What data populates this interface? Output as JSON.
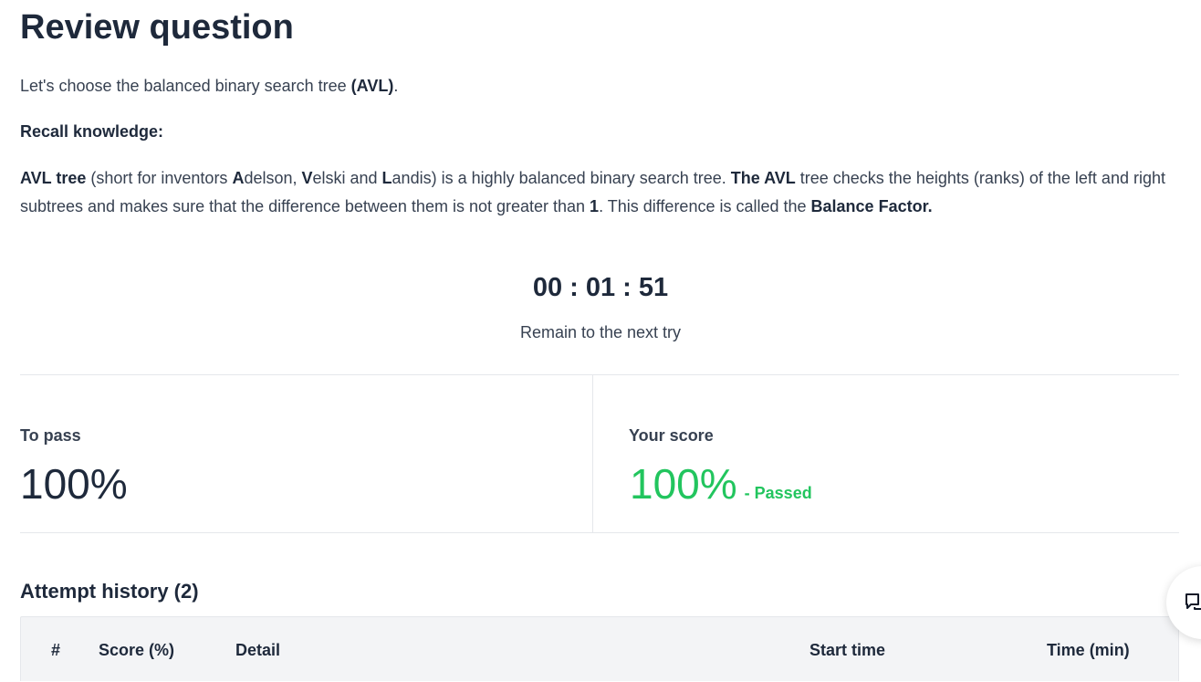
{
  "header": {
    "title": "Review question"
  },
  "intro": {
    "text": "Let's choose the balanced binary search tree ",
    "bold": "(AVL)",
    "end": "."
  },
  "recall": {
    "label": "Recall knowledge:"
  },
  "knowledge": {
    "p1_bold": "AVL tree",
    "p2": " (short for inventors ",
    "p3_bold": "A",
    "p4": "delson, ",
    "p5_bold": "V",
    "p6": "elski and ",
    "p7_bold": "L",
    "p8": "andis) is a highly balanced binary search tree. ",
    "p9_bold": "The AVL",
    "p10": " tree checks the heights (ranks) of the left and right subtrees and makes sure that the difference between them is not greater than ",
    "p11_bold": "1",
    "p12": ". This difference is called the ",
    "p13_bold": "Balance Factor."
  },
  "timer": {
    "value": "00 : 01 : 51",
    "caption": "Remain to the next try"
  },
  "score": {
    "to_pass_label": "To pass",
    "to_pass_value": "100%",
    "your_score_label": "Your score",
    "your_score_value": "100%",
    "status": "- Passed",
    "colors": {
      "passed": "#22c55e"
    }
  },
  "history": {
    "title": "Attempt history (2)",
    "columns": [
      "#",
      "Score (%)",
      "Detail",
      "Start time",
      "Time (min)"
    ]
  },
  "chat_button": {
    "icon": "chat-icon"
  }
}
